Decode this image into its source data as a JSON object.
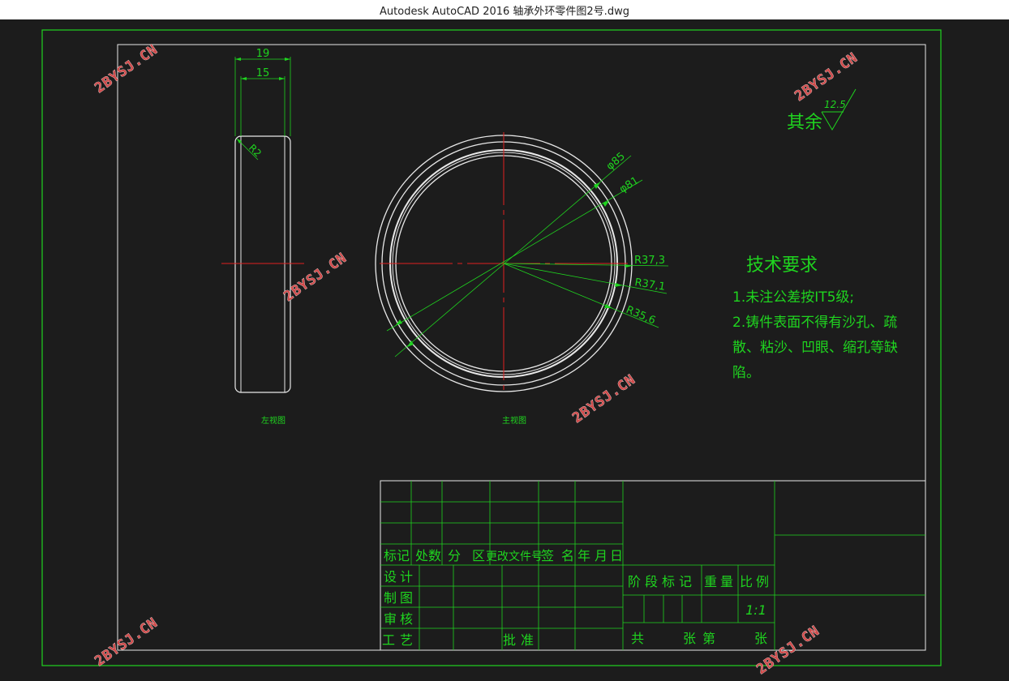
{
  "window": {
    "title": "Autodesk AutoCAD 2016     轴承外环零件图2号.dwg"
  },
  "drawing": {
    "left_view": {
      "dim_width_outer": "19",
      "dim_width_inner": "15",
      "fillet_radius": "R2",
      "caption": "左视图"
    },
    "front_view": {
      "dim_d1": "φ85",
      "dim_d2": "φ81",
      "dim_r1": "R37,3",
      "dim_r2": "R37,1",
      "dim_r3": "R35,6",
      "caption": "主视图"
    },
    "surface_finish": {
      "label": "其余",
      "value": "12.5"
    },
    "tech_requirements": {
      "title": "技术要求",
      "line1": "1.未注公差按IT5级;",
      "line2": "2.铸件表面不得有沙孔、疏",
      "line3": "散、粘沙、凹眼、缩孔等缺",
      "line4": "陷。"
    },
    "title_block": {
      "header": [
        "标记",
        "处数",
        "分",
        "区",
        "更改文件号",
        "签",
        "名",
        "年",
        "月",
        "日"
      ],
      "design": "设计",
      "draw": "制图",
      "check": "审核",
      "process": "工艺",
      "approve": "批准",
      "stage_mark": "阶段标记",
      "weight": "重量",
      "scale": "比例",
      "scale_value": "1:1",
      "total": "共",
      "sheets": "张",
      "sheet_no": "第",
      "sheet_unit": "张"
    },
    "watermark": "2BYSJ.CN"
  },
  "colors": {
    "background": "#1c1c1c",
    "frame_green": "#1fd41f",
    "line_white": "#e8e8e8",
    "center_red": "#e02020",
    "watermark": "#d04a4a"
  }
}
